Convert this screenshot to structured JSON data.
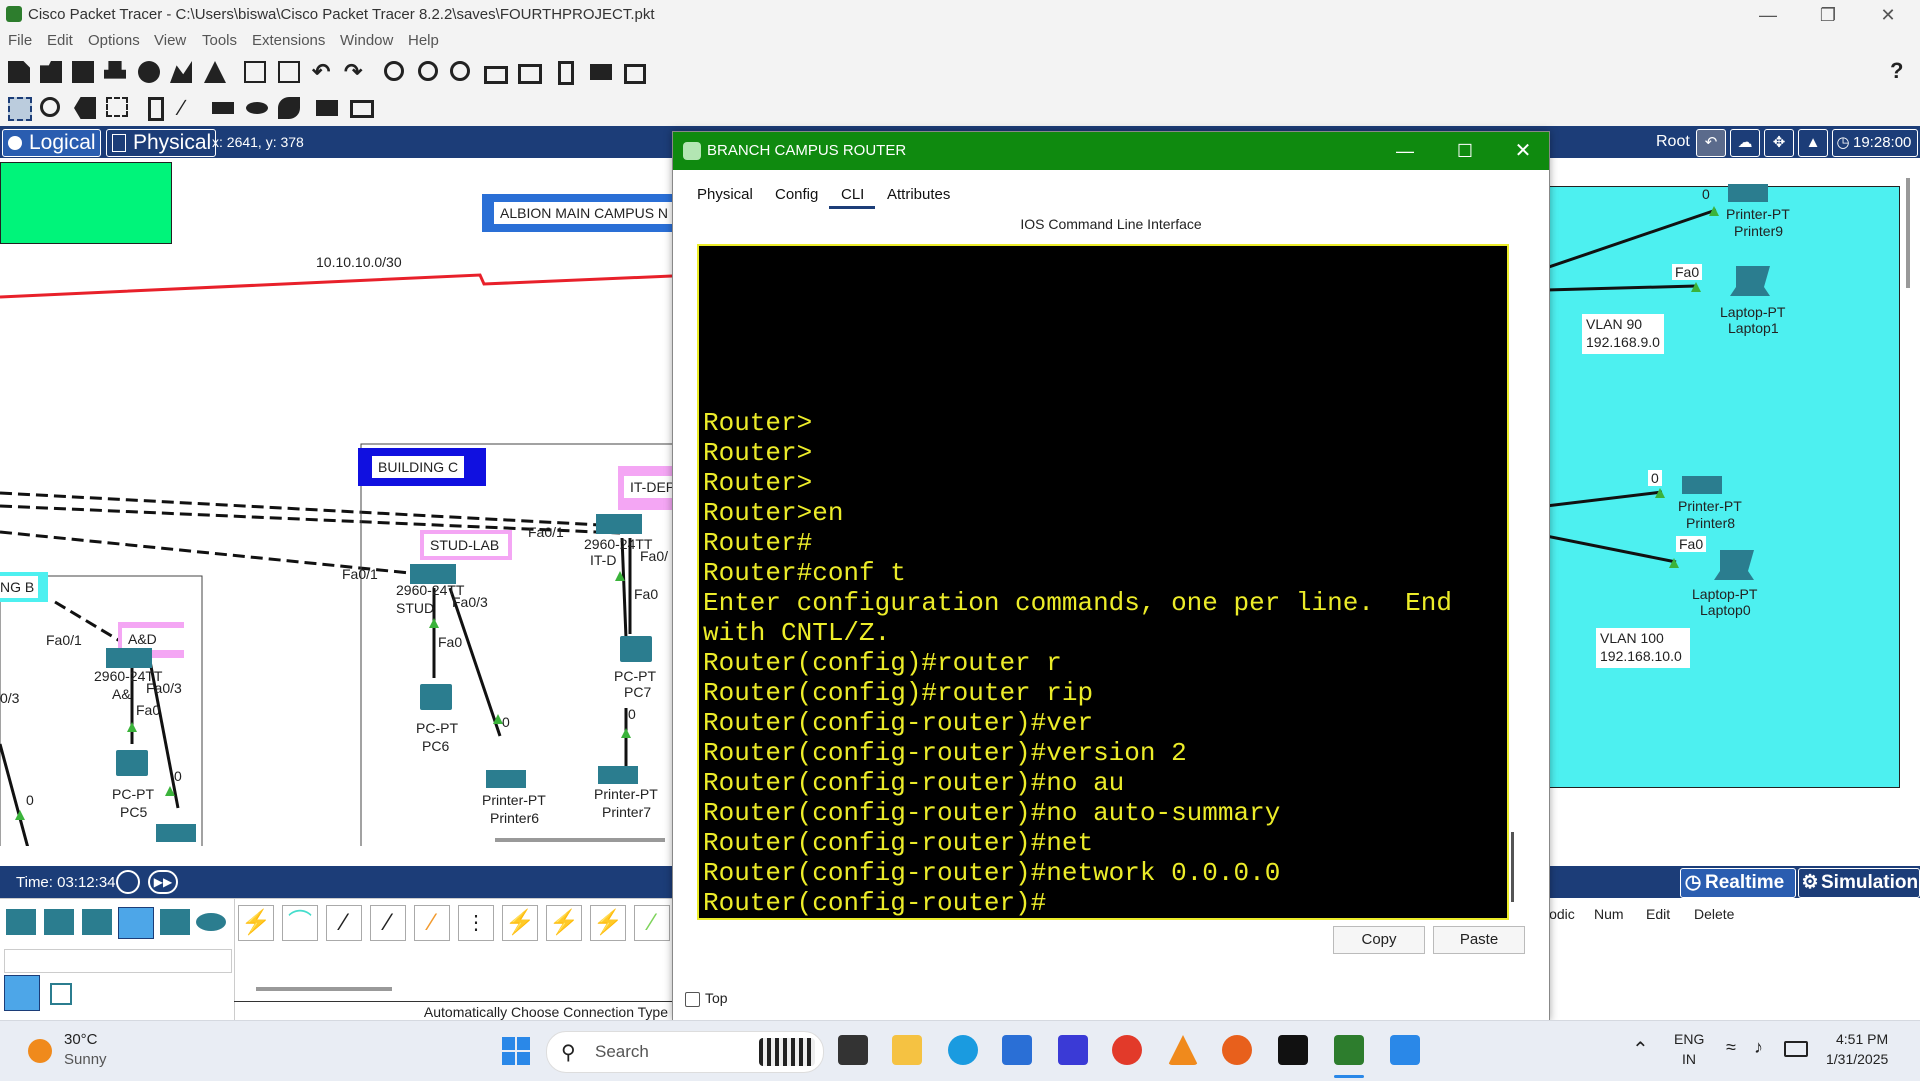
{
  "window": {
    "title": "Cisco Packet Tracer - C:\\Users\\biswa\\Cisco Packet Tracer 8.2.2\\saves\\FOURTHPROJECT.pkt",
    "help": "?"
  },
  "menu": [
    "File",
    "Edit",
    "Options",
    "View",
    "Tools",
    "Extensions",
    "Window",
    "Help"
  ],
  "workspace": {
    "logical_tab": "Logical",
    "physical_tab": "Physical",
    "coords": "x: 2641, y: 378",
    "root": "Root",
    "clock": "19:28:00"
  },
  "topology": {
    "albion_label": "ALBION MAIN CAMPUS N",
    "net_label": "10.10.10.0/30",
    "building_c": "BUILDING C",
    "stud_lab": "STUD-LAB",
    "it_dep": "IT-DEP",
    "ad_label": "A&D",
    "bldg_b": "NG B",
    "port_labels": [
      "Fa0/1",
      "Fa0/1",
      "Fa0/1",
      "Fa0/3",
      "Fa0/3",
      "Fa0",
      "Fa0",
      "Fa0",
      "Fa0/",
      "0/3",
      "0",
      "0",
      "0",
      "0"
    ],
    "sw_a": "2960-24TT",
    "sw_a2": "A&",
    "sw_stud": "2960-24TT",
    "sw_stud2": "STUD",
    "sw_it": "2960-24TT",
    "sw_it2": "IT-D",
    "pc5": [
      "PC-PT",
      "PC5"
    ],
    "pc6": [
      "PC-PT",
      "PC6"
    ],
    "pc7": [
      "PC-PT",
      "PC7"
    ],
    "printer6": [
      "Printer-PT",
      "Printer6"
    ],
    "printer7": [
      "Printer-PT",
      "Printer7"
    ],
    "printer9": [
      "Printer-PT",
      "Printer9"
    ],
    "printer8": [
      "Printer-PT",
      "Printer8"
    ],
    "laptop1": [
      "Laptop-PT",
      "Laptop1"
    ],
    "laptop0": [
      "Laptop-PT",
      "Laptop0"
    ],
    "vlan90": [
      "VLAN 90",
      "192.168.9.0"
    ],
    "vlan100": [
      "VLAN 100",
      "192.168.10.0"
    ],
    "fa0_r1": "Fa0",
    "fa0_r2": "Fa0",
    "zero_r1": "0",
    "zero_r2": "0"
  },
  "dialog": {
    "title": "BRANCH CAMPUS ROUTER",
    "tabs": [
      "Physical",
      "Config",
      "CLI",
      "Attributes"
    ],
    "active_tab": "CLI",
    "heading": "IOS Command Line Interface",
    "terminal": "Router>\nRouter>\nRouter>\nRouter>en\nRouter#\nRouter#conf t\nEnter configuration commands, one per line.  End with CNTL/Z.\nRouter(config)#router r\nRouter(config)#router rip\nRouter(config-router)#ver\nRouter(config-router)#version 2\nRouter(config-router)#no au\nRouter(config-router)#no auto-summary\nRouter(config-router)#net\nRouter(config-router)#network 0.0.0.0\nRouter(config-router)#",
    "copy": "Copy",
    "paste": "Paste",
    "top_checkbox": "Top"
  },
  "bottom": {
    "time": "Time: 03:12:34",
    "realtime": "Realtime",
    "simulation": "Simulation",
    "conn_type": "Automatically Choose Connection Type",
    "event_cols": [
      "iodic",
      "Num",
      "Edit",
      "Delete"
    ]
  },
  "taskbar": {
    "weather_temp": "30°C",
    "weather_desc": "Sunny",
    "search": "Search",
    "lang1": "ENG",
    "lang2": "IN",
    "time": "4:51 PM",
    "date": "1/31/2025"
  },
  "colors": {
    "title_green": "#0f8a0f",
    "terminal_fg": "#ecec29",
    "workspace_header": "#1c3d78",
    "cyan_area": "#4df0f0"
  }
}
